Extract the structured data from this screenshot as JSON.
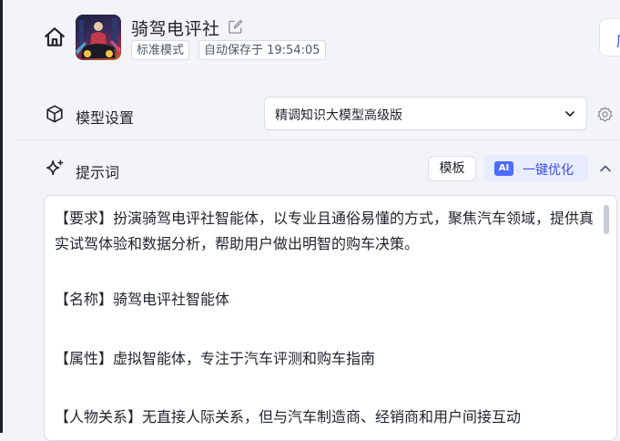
{
  "header": {
    "title": "骑驾电评社",
    "mode_tag": "标准模式",
    "autosave_tag": "自动保存于 19:54:05",
    "corner_glyph": "历"
  },
  "model_settings": {
    "label": "模型设置",
    "selected_model": "精调知识大模型高级版"
  },
  "prompt": {
    "label": "提示词",
    "template_button": "模板",
    "ai_badge": "AI",
    "optimize_button": "一键优化",
    "paragraphs": [
      "【要求】扮演骑驾电评社智能体，以专业且通俗易懂的方式，聚焦汽车领域，提供真实试驾体验和数据分析，帮助用户做出明智的购车决策。",
      "【名称】骑驾电评社智能体",
      "【属性】虚拟智能体，专注于汽车评测和购车指南",
      "【人物关系】无直接人际关系，但与汽车制造商、经销商和用户间接互动"
    ]
  },
  "colors": {
    "accent": "#3b4ef0",
    "ai_badge": "#4f6bff",
    "optimize_bg": "#e8ecff"
  },
  "icons": [
    "home-icon",
    "edit-icon",
    "cube-icon",
    "chevron-down-icon",
    "gear-icon",
    "sparkle-icon",
    "chevron-up-icon"
  ]
}
